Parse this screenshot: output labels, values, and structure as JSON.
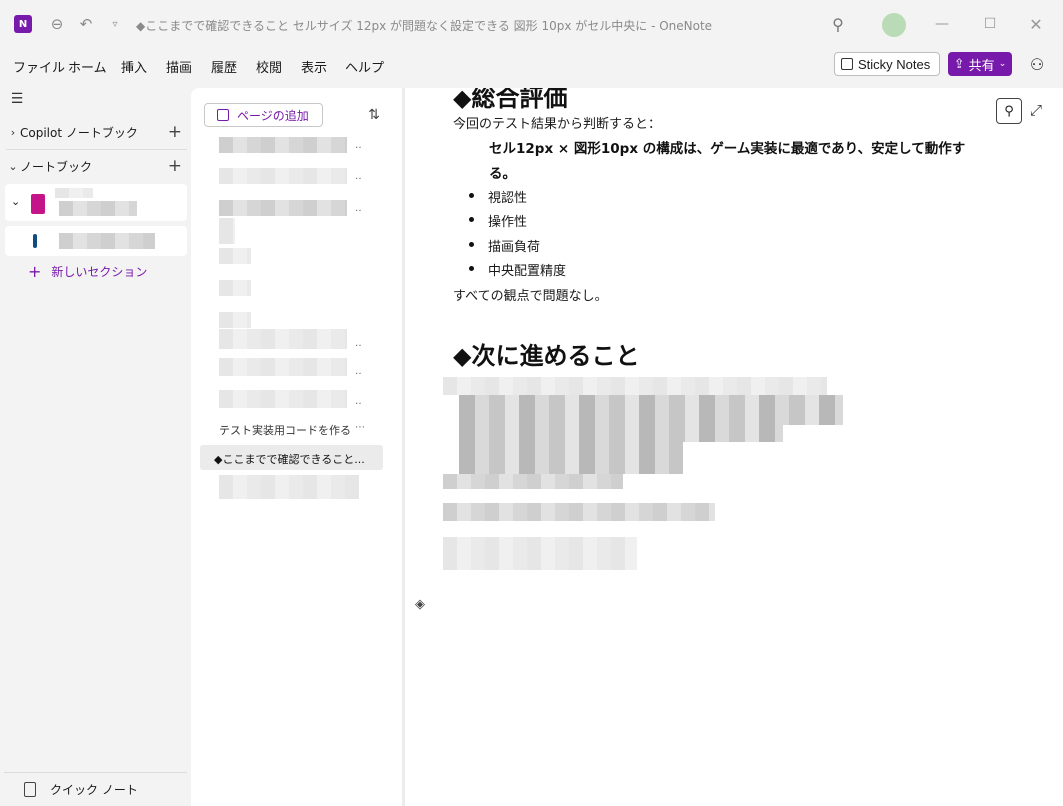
{
  "titlebar": {
    "title": "◆ここまでで確認できること セルサイズ 12px が問題なく設定できる 図形 10px がセル中央に - OneNote",
    "app_logo": "N"
  },
  "menubar": {
    "items": [
      "ファイル",
      "ホーム",
      "挿入",
      "描画",
      "履歴",
      "校閲",
      "表示",
      "ヘルプ"
    ],
    "sticky_notes": "Sticky Notes",
    "share": "共有"
  },
  "nav": {
    "copilot_notebooks": "Copilot ノートブック",
    "notebooks": "ノートブック",
    "new_section": "新しいセクション",
    "quick_note": "クイック ノート"
  },
  "pages": {
    "add_page": "ページの追加",
    "entry_test_code": "テスト実装用コードを作る",
    "entry_selected": "◆ここまでで確認できること..."
  },
  "content": {
    "heading_top": "◆総合評価",
    "intro": "今回のテスト結果から判断すると：",
    "bold_line1": "セル12px × 図形10px の構成は、ゲーム実装に最適であり、安定して動作す",
    "bold_line2": "る。",
    "bullets": [
      "視認性",
      "操作性",
      "描画負荷",
      "中央配置精度"
    ],
    "conclusion": "すべての観点で問題なし。",
    "heading_next": "◆次に進めること"
  },
  "colors": {
    "accent": "#7719aa",
    "notebook": "#c5138a",
    "section": "#0f4c81"
  }
}
